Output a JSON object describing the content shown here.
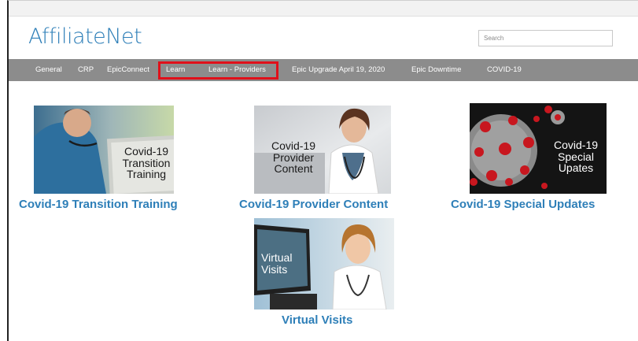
{
  "site": {
    "logo_text": "AffiliateNet"
  },
  "search": {
    "placeholder": "Search"
  },
  "nav": {
    "items": [
      {
        "label": "General"
      },
      {
        "label": "CRP"
      },
      {
        "label": "EpicConnect"
      },
      {
        "label": "Learn"
      },
      {
        "label": "Learn - Providers"
      },
      {
        "label": "Epic Upgrade April 19, 2020"
      },
      {
        "label": "Epic Downtime"
      },
      {
        "label": "COVID-19"
      }
    ],
    "highlight_color": "#e0101a"
  },
  "tiles": [
    {
      "image_text": "Covid-19\nTransition\nTraining",
      "caption": "Covid-19 Transition Training"
    },
    {
      "image_text": "Covid-19\nProvider\nContent",
      "caption": "Covid-19 Provider Content"
    },
    {
      "image_text": "Covid-19\nSpecial\nUpates",
      "caption": "Covid-19 Special Updates"
    },
    {
      "image_text": "Virtual\nVisits",
      "caption": "Virtual Visits"
    }
  ],
  "colors": {
    "accent": "#2e7fb8",
    "navbar": "#8c8c8c"
  }
}
